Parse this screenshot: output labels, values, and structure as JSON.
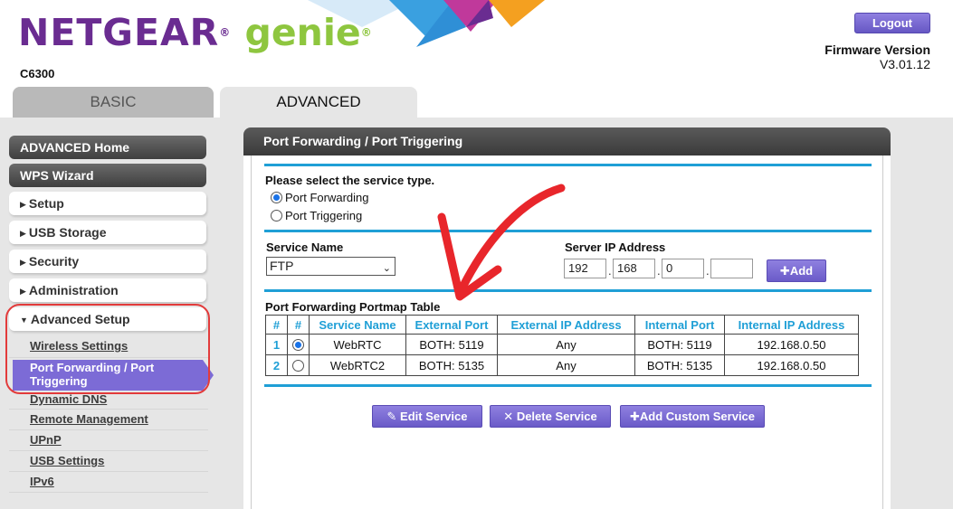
{
  "header": {
    "brand": "NETGEAR",
    "brand_reg": "®",
    "product": "genie",
    "product_reg": "®",
    "model": "C6300",
    "logout_label": "Logout",
    "firmware_title": "Firmware Version",
    "firmware_value": "V3.01.12"
  },
  "tabs": [
    {
      "label": "BASIC",
      "active": false
    },
    {
      "label": "ADVANCED",
      "active": true
    }
  ],
  "sidebar": {
    "top_items": [
      "ADVANCED Home",
      "WPS Wizard"
    ],
    "sections": [
      "Setup",
      "USB Storage",
      "Security",
      "Administration",
      "Advanced Setup"
    ],
    "sub_items": [
      "Wireless Settings",
      "Port Forwarding / Port Triggering",
      "Dynamic DNS",
      "Remote Management",
      "UPnP",
      "USB Settings",
      "IPv6"
    ],
    "active_sub": "Port Forwarding / Port Triggering"
  },
  "panel": {
    "title": "Port Forwarding / Port Triggering",
    "service_type_prompt": "Please select the service type.",
    "options": [
      {
        "label": "Port Forwarding",
        "selected": true
      },
      {
        "label": "Port Triggering",
        "selected": false
      }
    ],
    "service_name_label": "Service Name",
    "service_name_value": "FTP",
    "server_ip_label": "Server IP Address",
    "server_ip": [
      "192",
      "168",
      "0",
      ""
    ],
    "add_label": "Add",
    "table_title": "Port Forwarding Portmap Table",
    "columns": [
      "#",
      "Service Name",
      "External Port",
      "External IP Address",
      "Internal Port",
      "Internal IP Address"
    ],
    "rows": [
      {
        "num": "1",
        "selected": true,
        "service": "WebRTC",
        "ext_port": "BOTH: 5119",
        "ext_ip": "Any",
        "int_port": "BOTH: 5119",
        "int_ip": "192.168.0.50"
      },
      {
        "num": "2",
        "selected": false,
        "service": "WebRTC2",
        "ext_port": "BOTH: 5135",
        "ext_ip": "Any",
        "int_port": "BOTH: 5135",
        "int_ip": "192.168.0.50"
      }
    ],
    "buttons": [
      "Edit Service",
      "Delete Service",
      "Add Custom Service"
    ]
  },
  "colors": {
    "brand_purple": "#6a2c91",
    "genie_green": "#8ec63f",
    "accent_blue": "#1f9fd6",
    "button_purple": "#7c6bd6",
    "highlight_red": "#e23b3b"
  }
}
